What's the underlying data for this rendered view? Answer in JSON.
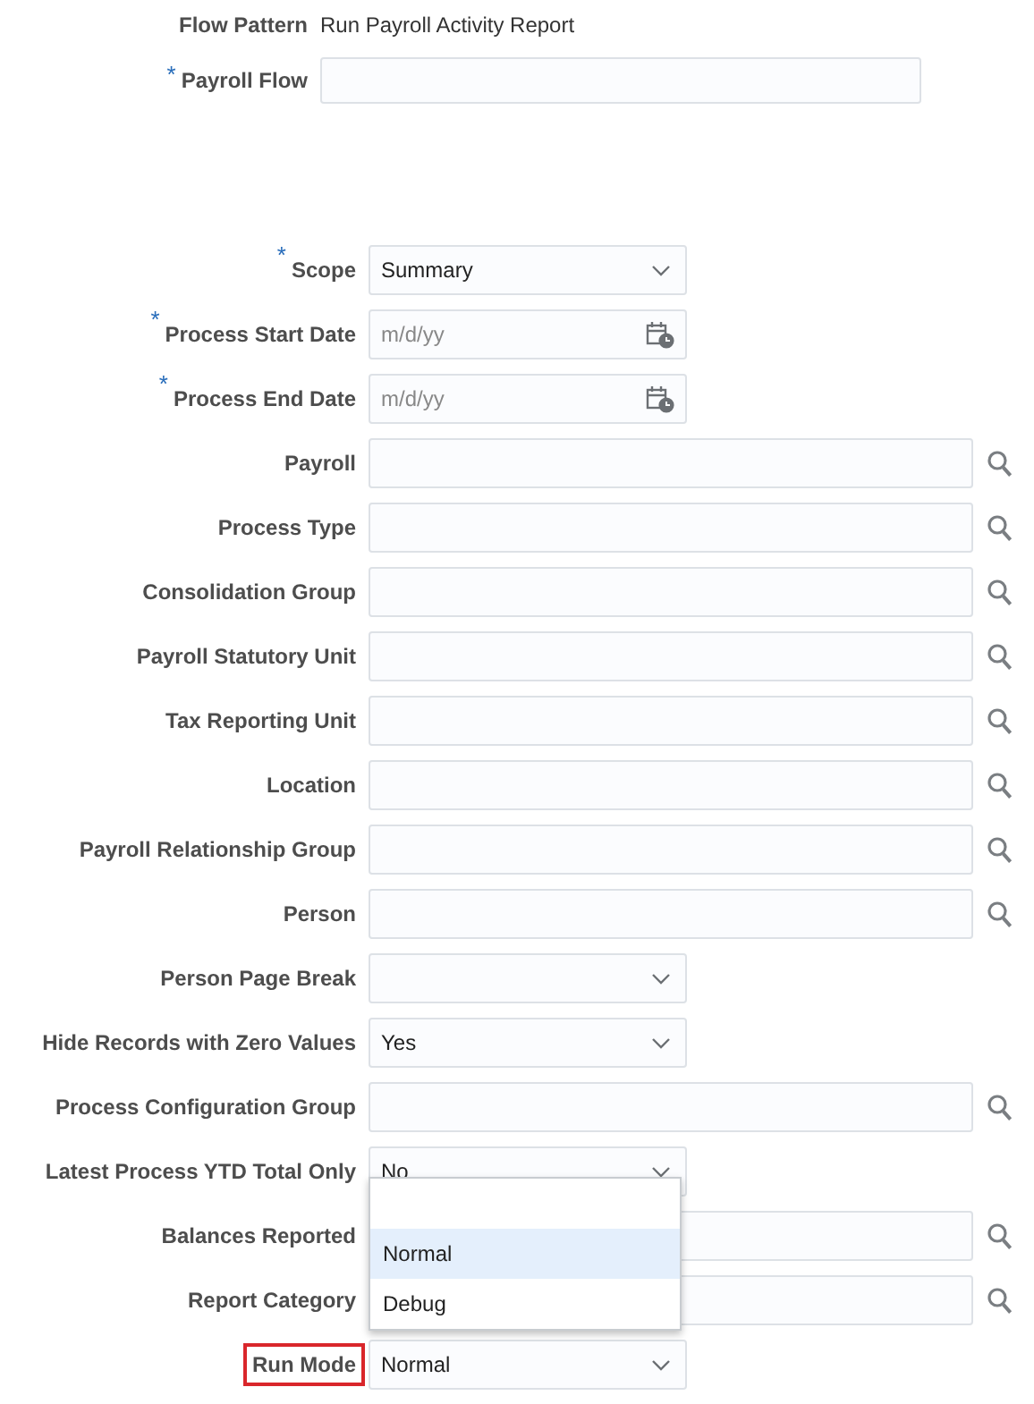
{
  "header": {
    "flow_pattern": {
      "label": "Flow Pattern",
      "value": "Run Payroll Activity Report"
    },
    "payroll_flow": {
      "label": "Payroll Flow",
      "marker": "*"
    }
  },
  "fields": [
    {
      "label": "Scope",
      "marker": "*",
      "kind": "select",
      "value": "Summary",
      "highlighted": false
    },
    {
      "label": "Process Start Date",
      "marker": "*",
      "kind": "date",
      "placeholder": "m/d/yy",
      "highlighted": false
    },
    {
      "label": "Process End Date",
      "marker": "*",
      "kind": "date",
      "placeholder": "m/d/yy",
      "highlighted": false
    },
    {
      "label": "Payroll",
      "kind": "search",
      "highlighted": false
    },
    {
      "label": "Process Type",
      "kind": "search",
      "highlighted": false
    },
    {
      "label": "Consolidation Group",
      "kind": "search",
      "highlighted": false
    },
    {
      "label": "Payroll Statutory Unit",
      "kind": "search",
      "highlighted": false
    },
    {
      "label": "Tax Reporting Unit",
      "kind": "search",
      "highlighted": false
    },
    {
      "label": "Location",
      "kind": "search",
      "highlighted": false
    },
    {
      "label": "Payroll Relationship Group",
      "kind": "search",
      "highlighted": false
    },
    {
      "label": "Person",
      "kind": "search",
      "highlighted": false
    },
    {
      "label": "Person Page Break",
      "kind": "select",
      "highlighted": false
    },
    {
      "label": "Hide Records with Zero Values",
      "kind": "select",
      "value": "Yes",
      "highlighted": false
    },
    {
      "label": "Process Configuration Group",
      "kind": "search",
      "highlighted": false
    },
    {
      "label": "Latest Process YTD Total Only",
      "kind": "select",
      "value": "No",
      "highlighted": false
    },
    {
      "label": "Balances Reported",
      "kind": "search",
      "highlighted": false
    },
    {
      "label": "Report Category",
      "kind": "search",
      "highlighted": false
    },
    {
      "label": "Run Mode",
      "kind": "select",
      "value": "Normal",
      "highlighted": true,
      "expanded": true,
      "options": [
        {
          "label": "Normal",
          "selected": true
        },
        {
          "label": "Debug",
          "selected": false
        }
      ]
    }
  ]
}
